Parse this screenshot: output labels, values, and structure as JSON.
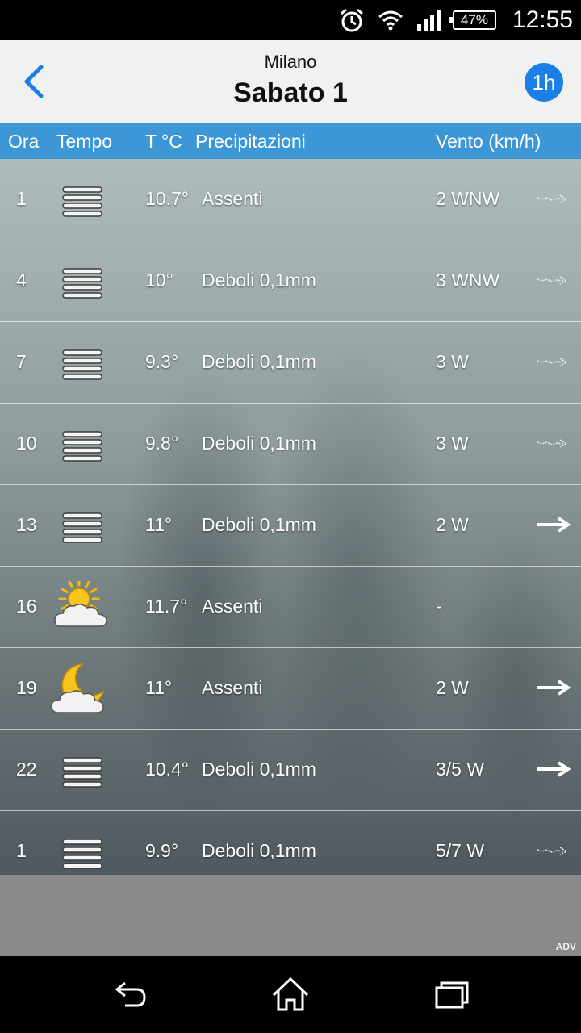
{
  "status_bar": {
    "battery": "47%",
    "time": "12:55",
    "icons": [
      "alarm-icon",
      "wifi-icon",
      "signal-icon",
      "battery-icon"
    ]
  },
  "header": {
    "city": "Milano",
    "date": "Sabato 1",
    "interval_button": "1h",
    "back_icon": "chevron-left-icon"
  },
  "columns": {
    "hour": "Ora",
    "weather": "Tempo",
    "temp": "T °C",
    "precip": "Precipitazioni",
    "wind": "Vento (km/h)"
  },
  "rows": [
    {
      "hour": "1",
      "weather": "fog",
      "temp": "10.7°",
      "precip": "Assenti",
      "wind": "2 WNW",
      "arrow": "faint"
    },
    {
      "hour": "4",
      "weather": "fog",
      "temp": "10°",
      "precip": "Deboli 0,1mm",
      "wind": "3 WNW",
      "arrow": "faint"
    },
    {
      "hour": "7",
      "weather": "fog",
      "temp": "9.3°",
      "precip": "Deboli 0,1mm",
      "wind": "3 W",
      "arrow": "faint"
    },
    {
      "hour": "10",
      "weather": "fog",
      "temp": "9.8°",
      "precip": "Deboli 0,1mm",
      "wind": "3 W",
      "arrow": "faint"
    },
    {
      "hour": "13",
      "weather": "fog",
      "temp": "11°",
      "precip": "Deboli 0,1mm",
      "wind": "2 W",
      "arrow": "solid"
    },
    {
      "hour": "16",
      "weather": "sun-cloud",
      "temp": "11.7°",
      "precip": "Assenti",
      "wind": "-",
      "arrow": "none"
    },
    {
      "hour": "19",
      "weather": "moon-cloud",
      "temp": "11°",
      "precip": "Assenti",
      "wind": "2 W",
      "arrow": "solid"
    },
    {
      "hour": "22",
      "weather": "fog",
      "temp": "10.4°",
      "precip": "Deboli 0,1mm",
      "wind": "3/5 W",
      "arrow": "solid"
    },
    {
      "hour": "1",
      "weather": "fog",
      "temp": "9.9°",
      "precip": "Deboli 0,1mm",
      "wind": "5/7 W",
      "arrow": "faint"
    }
  ],
  "ad": {
    "label": "ADV"
  },
  "nav": {
    "back_icon": "back-icon",
    "home_icon": "home-icon",
    "recents_icon": "recents-icon"
  },
  "colors": {
    "accent": "#1a7fe6",
    "header_bar": "#3d97d6"
  }
}
